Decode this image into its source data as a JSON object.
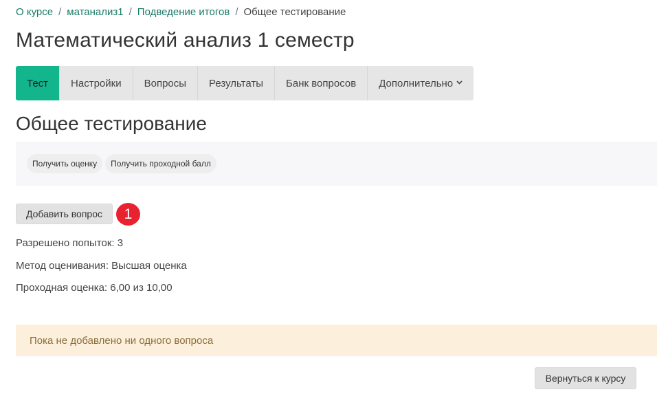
{
  "breadcrumb": {
    "items": [
      "О курсе",
      "матанализ1",
      "Подведение итогов"
    ],
    "current": "Общее тестирование",
    "separator": "/"
  },
  "page_title": "Математический анализ 1 семестр",
  "tabs": [
    {
      "label": "Тест",
      "active": true
    },
    {
      "label": "Настройки",
      "active": false
    },
    {
      "label": "Вопросы",
      "active": false
    },
    {
      "label": "Результаты",
      "active": false
    },
    {
      "label": "Банк вопросов",
      "active": false
    },
    {
      "label": "Дополнительно",
      "active": false,
      "dropdown": true
    }
  ],
  "section_title": "Общее тестирование",
  "subnav": {
    "get_grade": "Получить оценку",
    "get_pass_score": "Получить проходной балл"
  },
  "add_question_label": "Добавить вопрос",
  "badge": "1",
  "info": {
    "attempts": "Разрешено попыток: 3",
    "grading_method": "Метод оценивания: Высшая оценка",
    "pass_grade": "Проходная оценка: 6,00 из 10,00"
  },
  "alert_text": "Пока не добавлено ни одного вопроса",
  "back_button": "Вернуться к курсу",
  "colors": {
    "accent": "#12b58c",
    "link": "#1a7a66",
    "badge": "#e8232f",
    "alert_bg": "#fcefdc"
  }
}
